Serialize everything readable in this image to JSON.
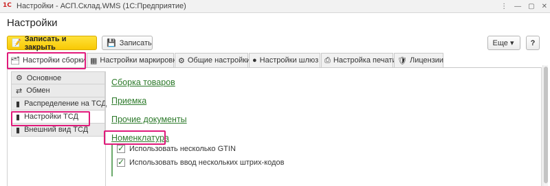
{
  "window": {
    "logo": "1С",
    "title": "Настройки - АСП.Склад.WMS (1С:Предприятие)",
    "controls": [
      "⋮",
      "—",
      "▢",
      "✕"
    ]
  },
  "header": {
    "title": "Настройки"
  },
  "toolbar": {
    "save_close_label": "Записать и закрыть",
    "save_label": "Записать",
    "more_label": "Еще ▾",
    "help_label": "?"
  },
  "tabs": [
    {
      "label": "Настройки сборки",
      "icon": "build-settings-icon",
      "glyph": "🗂"
    },
    {
      "label": "Настройки маркировки",
      "icon": "qr-code-icon",
      "glyph": "▦"
    },
    {
      "label": "Общие настройки",
      "icon": "gear-icon",
      "glyph": "⚙"
    },
    {
      "label": "Настройки шлюз",
      "icon": "gateway-icon",
      "glyph": "●"
    },
    {
      "label": "Настройка печати",
      "icon": "printer-icon",
      "glyph": "⎙"
    },
    {
      "label": "Лицензии",
      "icon": "license-shield-icon",
      "glyph": "🛡"
    }
  ],
  "sidebar": {
    "items": [
      {
        "label": "Основное",
        "icon": "gear-icon",
        "glyph": "⚙"
      },
      {
        "label": "Обмен",
        "icon": "exchange-icon",
        "glyph": "⇄"
      },
      {
        "label": "Распределение на ТСД",
        "icon": "handheld-device-icon",
        "glyph": "▮"
      },
      {
        "label": "Настройки ТСД",
        "icon": "handheld-device-icon",
        "glyph": "▮"
      },
      {
        "label": "Внешний вид ТСД",
        "icon": "handheld-device-icon",
        "glyph": "▮"
      }
    ]
  },
  "main": {
    "links": [
      "Сборка товаров",
      "Приемка",
      "Прочие документы",
      "Номенклатура"
    ],
    "checkboxes": [
      {
        "label": "Использовать несколько GTIN",
        "checked": true
      },
      {
        "label": "Использовать ввод нескольких штрих-кодов",
        "checked": true
      }
    ]
  },
  "colors": {
    "accent": "#f8c904",
    "link": "#2d7a2b",
    "highlight": "#e0197a"
  }
}
